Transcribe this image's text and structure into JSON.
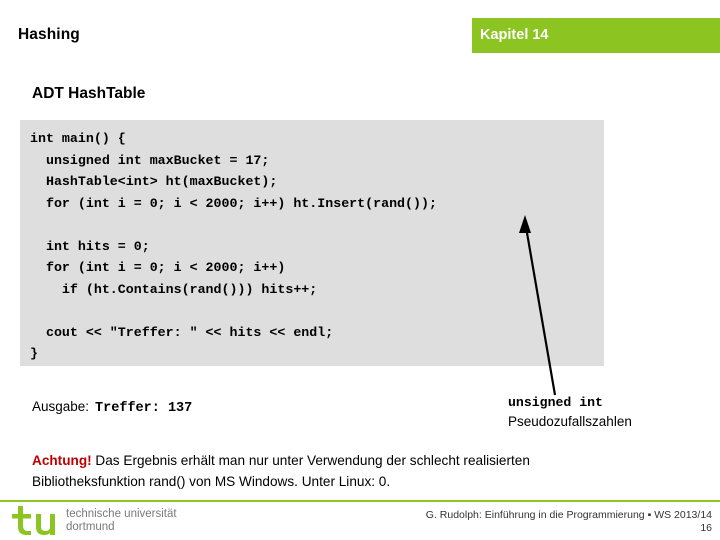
{
  "header": {
    "title": "Hashing",
    "chapter": "Kapitel 14",
    "accent_color": "#8CC522"
  },
  "slide": {
    "title": "ADT HashTable"
  },
  "code": {
    "background_color": "#dedede",
    "lines": [
      "int main() {",
      "  unsigned int maxBucket = 17;",
      "  HashTable<int> ht(maxBucket);",
      "  for (int i = 0; i < 2000; i++) ht.Insert(rand());",
      "",
      "  int hits = 0;",
      "  for (int i = 0; i < 2000; i++)",
      "    if (ht.Contains(rand())) hits++;",
      "",
      "  cout << \"Treffer: \" << hits << endl;",
      "}"
    ]
  },
  "output": {
    "label": "Ausgabe:",
    "value": "Treffer: 137"
  },
  "annotation": {
    "line1": "unsigned int",
    "line2": "Pseudozufallszahlen"
  },
  "warning": {
    "lead": "Achtung!",
    "text": " Das Ergebnis erhält man nur unter Verwendung der schlecht realisierten Bibliotheksfunktion rand() von MS Windows. Unter Linux: 0.",
    "lead_color": "#C00000"
  },
  "footer": {
    "logo_line1": "technische universität",
    "logo_line2": "dortmund",
    "logo_color": "#8CC522",
    "credit": "G. Rudolph: Einführung in die Programmierung ▪ WS 2013/14",
    "page": "16"
  }
}
